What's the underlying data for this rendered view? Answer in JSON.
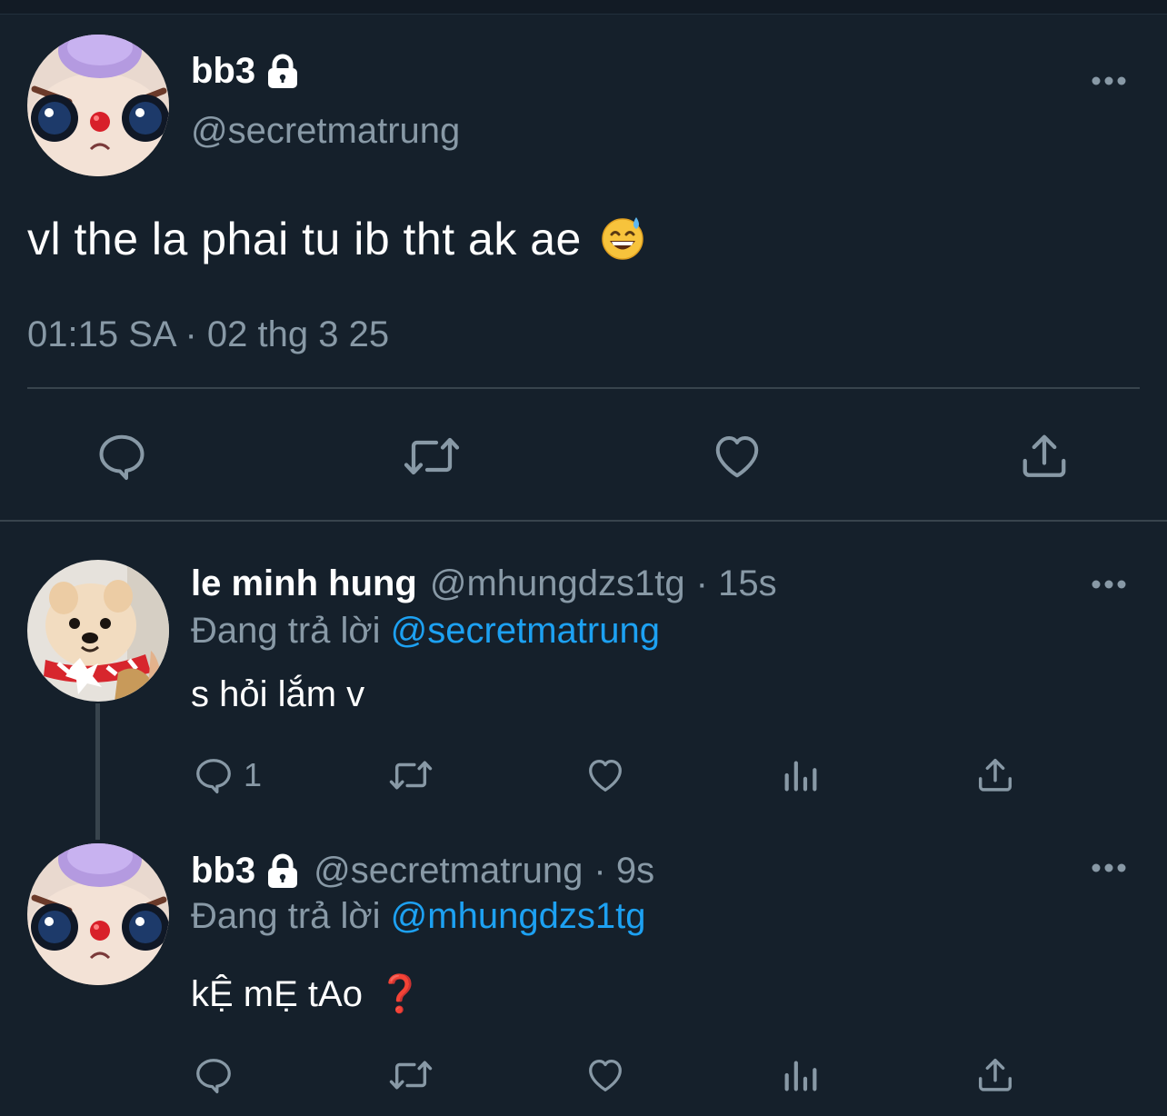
{
  "main_tweet": {
    "name": "bb3",
    "handle": "@secretmatrung",
    "text": "vl the la phai tu ib tht ak ae",
    "emoji": "grinning-face-with-sweat",
    "timestamp": "01:15 SA · 02 thg 3 25",
    "actions": [
      "reply-icon",
      "retweet-icon",
      "like-icon",
      "share-icon"
    ]
  },
  "replies": [
    {
      "name": "le minh hung",
      "handle": "@mhungdzs1tg",
      "time": "· 15s",
      "replying_prefix": "Đang trả lời",
      "replying_to": "@secretmatrung",
      "text": "s hỏi lắm v",
      "reply_count": "1"
    },
    {
      "name": "bb3",
      "handle": "@secretmatrung",
      "time": "· 9s",
      "replying_prefix": "Đang trả lời",
      "replying_to": "@mhungdzs1tg",
      "text": "kỆ mẸ tAo",
      "suffix_glyph": "❓",
      "reply_count": ""
    }
  ],
  "colors": {
    "background": "#15202b",
    "secondary_text": "#8899a6",
    "mention": "#1da1f2",
    "divider": "#38444d"
  }
}
